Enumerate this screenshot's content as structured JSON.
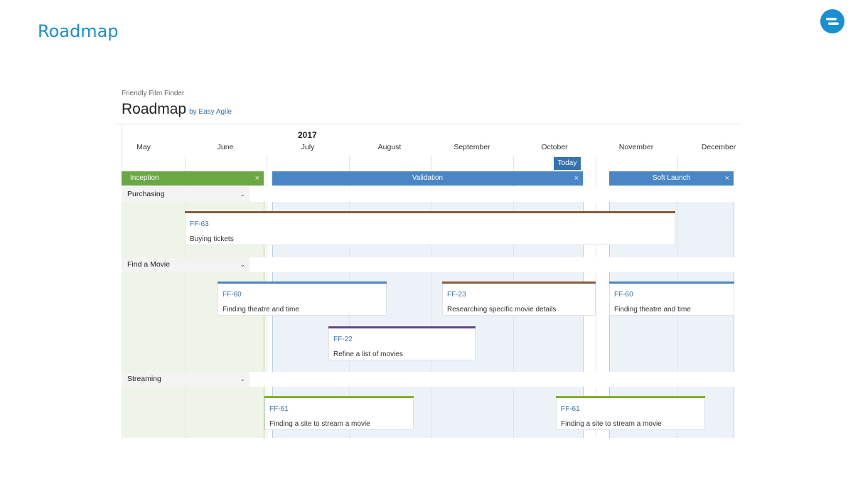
{
  "slide": {
    "title": "Roadmap"
  },
  "logo": {
    "icon": "easy-agile-logo-icon",
    "color": "#1a8fd1"
  },
  "app": {
    "project": "Friendly Film Finder",
    "title": "Roadmap",
    "byline": "by Easy Agile"
  },
  "timeline": {
    "year": "2017",
    "months": [
      "May",
      "June",
      "July",
      "August",
      "September",
      "October",
      "November",
      "December"
    ],
    "today_label": "Today"
  },
  "phases": [
    {
      "label": "Inception",
      "color": "#6aa843",
      "close": "×"
    },
    {
      "label": "Validation",
      "color": "#4a86c5",
      "close": "×"
    },
    {
      "label": "Soft Launch",
      "color": "#4a86c5",
      "close": "×"
    }
  ],
  "themes": [
    {
      "label": "Purchasing",
      "chevron": "⌄"
    },
    {
      "label": "Find a Movie",
      "chevron": "⌄"
    },
    {
      "label": "Streaming",
      "chevron": "⌄"
    }
  ],
  "cards": [
    {
      "key": "FF-63",
      "summary": "Buying tickets",
      "color": "#8b5a3c"
    },
    {
      "key": "FF-60",
      "summary": "Finding theatre and time",
      "color": "#4a86c5"
    },
    {
      "key": "FF-23",
      "summary": "Researching specific movie details",
      "color": "#8b5a3c"
    },
    {
      "key": "FF-60",
      "summary": "Finding theatre and time",
      "color": "#4a86c5"
    },
    {
      "key": "FF-22",
      "summary": "Refine a list of movies",
      "color": "#654982"
    },
    {
      "key": "FF-61",
      "summary": "Finding a site to stream a movie",
      "color": "#7fb32d"
    },
    {
      "key": "FF-61",
      "summary": "Finding a site to stream a movie",
      "color": "#7fb32d"
    }
  ]
}
